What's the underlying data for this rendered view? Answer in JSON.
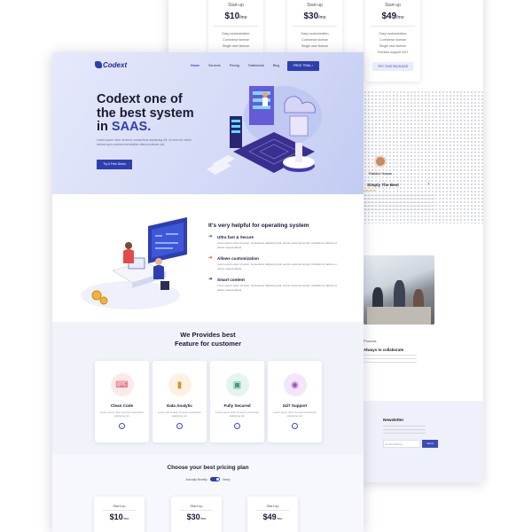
{
  "back_page": {
    "plans": [
      {
        "label": "Start-up",
        "price": "$10",
        "per": "/mo",
        "features": [
          "Easy customization",
          "Commerce license",
          "Single user license"
        ],
        "cta": ""
      },
      {
        "label": "Start-up",
        "price": "$30",
        "per": "/mo",
        "features": [
          "Easy customization",
          "Commerce license",
          "Single user license"
        ],
        "cta": ""
      },
      {
        "label": "Start-up",
        "price": "$49",
        "per": "/mo",
        "features": [
          "Easy customization",
          "Commerce license",
          "Single user license",
          "Full time support 24/7"
        ],
        "cta": "TRY THIS PACKAGE"
      }
    ],
    "testimonial": {
      "name": "Rakibul Hasan",
      "headline": "Simply The Best",
      "stars": "★★★★★"
    },
    "about": {
      "kicker": "Process",
      "headline": "Always to collaborate"
    },
    "newsletter": {
      "title": "Newsletter",
      "placeholder": "Email Address",
      "button": "Send"
    }
  },
  "header": {
    "logo": "Codext",
    "nav": [
      "Home",
      "Services",
      "Pricing",
      "Testimonial",
      "Blog"
    ],
    "cta": "FREE TRIAL  ›"
  },
  "hero": {
    "title_line1": "Codext one of",
    "title_line2": "the best system",
    "title_prefix": "in ",
    "title_accent": "SAAS.",
    "subtitle": "Lorem ipsum dolor sit amet, consectetur adipiscing elit. Ut enim ad minim veniam quis nostrud exercitation ullamco laboris nisi.",
    "button": "Try A Free Demo"
  },
  "help_section": {
    "title": "It's very helpful for operating system",
    "features": [
      {
        "title": "Ultra fast & Secure",
        "text": "Lorem ipsum dolor sit amet, consectetur adipiscing elit, sed do eiusmod tempor incididunt ut labore et dolore magna aliqua.",
        "color": "#2f9e5b"
      },
      {
        "title": "Allows customization",
        "text": "Lorem ipsum dolor sit amet, consectetur adipiscing elit, sed do eiusmod tempor incididunt ut labore et dolore magna aliqua.",
        "color": "#e0742b"
      },
      {
        "title": "Smart content",
        "text": "Lorem ipsum dolor sit amet, consectetur adipiscing elit, sed do eiusmod tempor incididunt ut labore et dolore magna aliqua.",
        "color": "#3b4bb8"
      }
    ]
  },
  "provides": {
    "title_line1": "We Provides best",
    "title_line2": "Feature for customer",
    "cards": [
      {
        "title": "Clean Code",
        "text": "Lorem ipsum dolor sit amet consectetur adipiscing elit.",
        "icon": "code-icon",
        "glyph": "⌨",
        "bg": "#fde8ea",
        "fg": "#d9545e"
      },
      {
        "title": "Data Analytic",
        "text": "Lorem ipsum dolor sit amet consectetur adipiscing elit.",
        "icon": "chart-icon",
        "glyph": "📊",
        "bg": "#fdf1e2",
        "fg": "#d98f2b"
      },
      {
        "title": "Fully Secured",
        "text": "Lorem ipsum dolor sit amet consectetur adipiscing elit.",
        "icon": "lock-icon",
        "glyph": "🔒",
        "bg": "#e4f4ee",
        "fg": "#3f9d78"
      },
      {
        "title": "24/7 Support",
        "text": "Lorem ipsum dolor sit amet consectetur adipiscing elit.",
        "icon": "support-icon",
        "glyph": "🎧",
        "bg": "#f3e6fa",
        "fg": "#a04fc8"
      }
    ]
  },
  "pricing": {
    "title": "Choose your best pricing plan",
    "billing_monthly": "Annually Monthly",
    "billing_yearly": "Yearly",
    "plans": [
      {
        "label": "Start-up",
        "price": "$10",
        "per": "/mo"
      },
      {
        "label": "Start-up",
        "price": "$30",
        "per": "/mo"
      },
      {
        "label": "Start-up",
        "price": "$49",
        "per": "/mo"
      }
    ]
  },
  "colors": {
    "primary": "#2d3fb0",
    "hero_bg": "#d5dbf7",
    "section_bg": "#f1f3fb"
  }
}
